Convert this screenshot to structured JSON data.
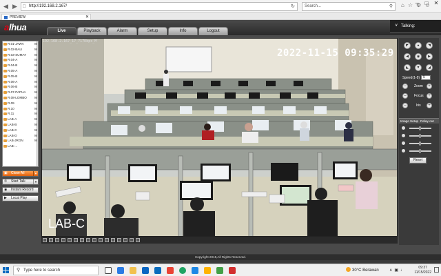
{
  "browser": {
    "url": "http://192.168.2.167/",
    "search_placeholder": "Search...",
    "tab_title": "PREVIEW"
  },
  "app": {
    "logo_prefix": "a",
    "logo_rest": "lhua",
    "menu": [
      {
        "label": "Live",
        "active": true
      },
      {
        "label": "Playback",
        "active": false
      },
      {
        "label": "Alarm",
        "active": false
      },
      {
        "label": "Setup",
        "active": false
      },
      {
        "label": "Info",
        "active": false
      },
      {
        "label": "Logout",
        "active": false
      }
    ],
    "talking_label": "Talking:"
  },
  "channels": [
    {
      "name": "R.01-JAWA",
      "mark": "M"
    },
    {
      "name": "R.02-BALI",
      "mark": "M"
    },
    {
      "name": "R.03-SUMAT",
      "mark": "M"
    },
    {
      "name": "R.04-A",
      "mark": "M"
    },
    {
      "name": "R.04-B",
      "mark": "M"
    },
    {
      "name": "R.05-A",
      "mark": "M"
    },
    {
      "name": "R.05-B",
      "mark": "M"
    },
    {
      "name": "R.06-A",
      "mark": "M"
    },
    {
      "name": "R.06-B",
      "mark": "M"
    },
    {
      "name": "R.07-PAPUA",
      "mark": "M"
    },
    {
      "name": "R.08-LOMBO",
      "mark": "M"
    },
    {
      "name": "R.09",
      "mark": "M"
    },
    {
      "name": "R.10",
      "mark": "M"
    },
    {
      "name": "R.11",
      "mark": "M"
    },
    {
      "name": "LAB-A",
      "mark": "M"
    },
    {
      "name": "LAB-B",
      "mark": "M"
    },
    {
      "name": "LAB-C",
      "mark": "M"
    },
    {
      "name": "LAB-D",
      "mark": "M"
    },
    {
      "name": "LAB-JRGN",
      "mark": "M"
    },
    {
      "name": "LAB-...",
      "mark": ""
    }
  ],
  "left_buttons": {
    "close_all": "Close All",
    "start_talk": "Start Talk",
    "instant_record": "Instant Record",
    "local_play": "Local Play"
  },
  "video": {
    "info": "192.168.2.167_17_717Kbps_M",
    "timestamp": "2022-11-15 09:35:29",
    "channel_name": "LAB-C"
  },
  "ptz": {
    "speed_label": "Speed(1-8)",
    "speed_value": "5",
    "zoom_label": "Zoom",
    "focus_label": "Focus",
    "iris_label": "Iris",
    "image_setup": "Image Setup",
    "relay_out": "Relay-out",
    "reset": "Reset"
  },
  "footer": {
    "copyright": "Copyright 2015,All Rights Reserved."
  },
  "taskbar": {
    "search": "Type here to search",
    "temp": "30°C",
    "weather": "Berawan",
    "time": "09:37",
    "date": "11/15/2022"
  },
  "colors": {
    "accent": "#e60012",
    "orange": "#e2620e"
  }
}
